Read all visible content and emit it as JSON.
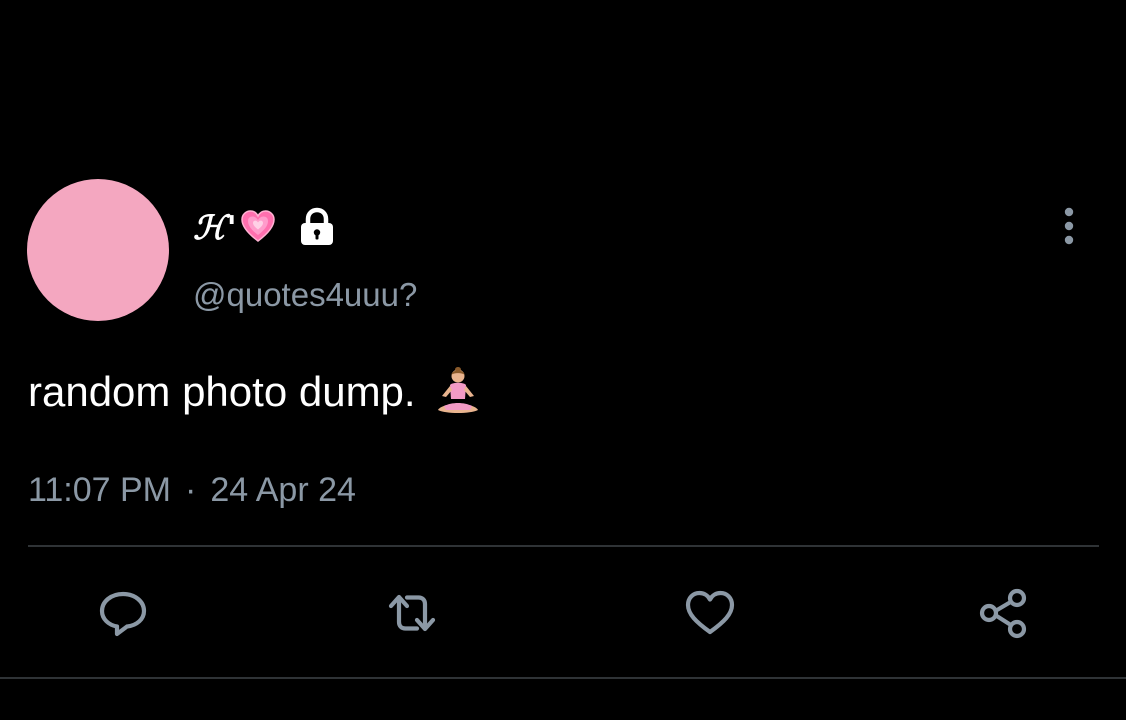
{
  "tweet": {
    "display_name": "ℋ'",
    "handle": "@quotes4uuu?",
    "text": "random photo dump.",
    "time": "11:07 PM",
    "separator": "·",
    "date": "24 Apr 24"
  },
  "icons": {
    "name_emoji": "growing-heart-icon",
    "protected": "lock-icon",
    "more": "more-vertical-icon",
    "text_emoji": "yoga-icon",
    "actions": [
      "reply-icon",
      "retweet-icon",
      "like-icon",
      "share-icon"
    ]
  },
  "colors": {
    "background": "#000000",
    "avatar": "#f4a7c0",
    "secondary_text": "#8b98a5",
    "divider": "#2f3336",
    "heart": "#ff6fae"
  }
}
